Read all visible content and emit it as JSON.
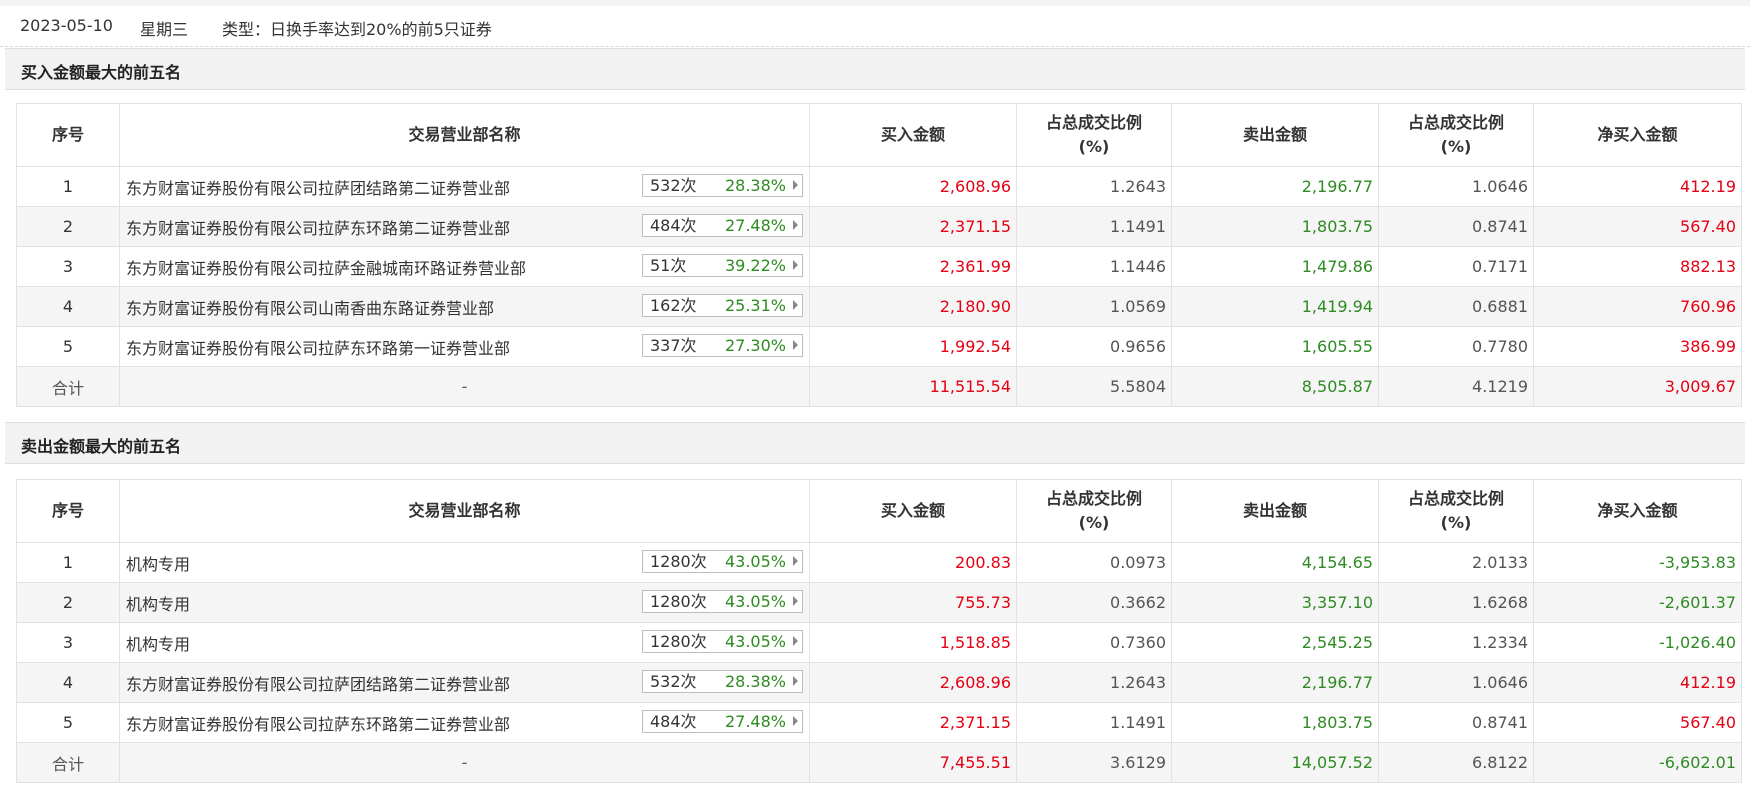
{
  "header": {
    "date": "2023-05-10",
    "weekday": "星期三",
    "type_text": "类型：日换手率达到20%的前5只证券"
  },
  "columns": {
    "idx": "序号",
    "name": "交易营业部名称",
    "buy": "买入金额",
    "buy_ratio_1": "占总成交比例",
    "buy_ratio_2": "(%)",
    "sell": "卖出金额",
    "sell_ratio_1": "占总成交比例",
    "sell_ratio_2": "(%)",
    "net": "净买入金额"
  },
  "colors": {
    "red": "#e60012",
    "green": "#2e8b22"
  },
  "buy_top5": {
    "title": "买入金额最大的前五名",
    "rows": [
      {
        "idx": "1",
        "name": "东方财富证券股份有限公司拉萨团结路第二证券营业部",
        "count": "532次",
        "rate": "28.38%",
        "buy": "2,608.96",
        "buy_ratio": "1.2643",
        "sell": "2,196.77",
        "sell_ratio": "1.0646",
        "net": "412.19",
        "net_sign": "pos"
      },
      {
        "idx": "2",
        "name": "东方财富证券股份有限公司拉萨东环路第二证券营业部",
        "count": "484次",
        "rate": "27.48%",
        "buy": "2,371.15",
        "buy_ratio": "1.1491",
        "sell": "1,803.75",
        "sell_ratio": "0.8741",
        "net": "567.40",
        "net_sign": "pos"
      },
      {
        "idx": "3",
        "name": "东方财富证券股份有限公司拉萨金融城南环路证券营业部",
        "count": "51次",
        "rate": "39.22%",
        "buy": "2,361.99",
        "buy_ratio": "1.1446",
        "sell": "1,479.86",
        "sell_ratio": "0.7171",
        "net": "882.13",
        "net_sign": "pos"
      },
      {
        "idx": "4",
        "name": "东方财富证券股份有限公司山南香曲东路证券营业部",
        "count": "162次",
        "rate": "25.31%",
        "buy": "2,180.90",
        "buy_ratio": "1.0569",
        "sell": "1,419.94",
        "sell_ratio": "0.6881",
        "net": "760.96",
        "net_sign": "pos"
      },
      {
        "idx": "5",
        "name": "东方财富证券股份有限公司拉萨东环路第一证券营业部",
        "count": "337次",
        "rate": "27.30%",
        "buy": "1,992.54",
        "buy_ratio": "0.9656",
        "sell": "1,605.55",
        "sell_ratio": "0.7780",
        "net": "386.99",
        "net_sign": "pos"
      }
    ],
    "total": {
      "label": "合计",
      "name": "-",
      "buy": "11,515.54",
      "buy_ratio": "5.5804",
      "sell": "8,505.87",
      "sell_ratio": "4.1219",
      "net": "3,009.67"
    }
  },
  "sell_top5": {
    "title": "卖出金额最大的前五名",
    "rows": [
      {
        "idx": "1",
        "name": "机构专用",
        "count": "1280次",
        "rate": "43.05%",
        "buy": "200.83",
        "buy_ratio": "0.0973",
        "sell": "4,154.65",
        "sell_ratio": "2.0133",
        "net": "-3,953.83",
        "net_sign": "neg"
      },
      {
        "idx": "2",
        "name": "机构专用",
        "count": "1280次",
        "rate": "43.05%",
        "buy": "755.73",
        "buy_ratio": "0.3662",
        "sell": "3,357.10",
        "sell_ratio": "1.6268",
        "net": "-2,601.37",
        "net_sign": "neg"
      },
      {
        "idx": "3",
        "name": "机构专用",
        "count": "1280次",
        "rate": "43.05%",
        "buy": "1,518.85",
        "buy_ratio": "0.7360",
        "sell": "2,545.25",
        "sell_ratio": "1.2334",
        "net": "-1,026.40",
        "net_sign": "neg"
      },
      {
        "idx": "4",
        "name": "东方财富证券股份有限公司拉萨团结路第二证券营业部",
        "count": "532次",
        "rate": "28.38%",
        "buy": "2,608.96",
        "buy_ratio": "1.2643",
        "sell": "2,196.77",
        "sell_ratio": "1.0646",
        "net": "412.19",
        "net_sign": "pos"
      },
      {
        "idx": "5",
        "name": "东方财富证券股份有限公司拉萨东环路第二证券营业部",
        "count": "484次",
        "rate": "27.48%",
        "buy": "2,371.15",
        "buy_ratio": "1.1491",
        "sell": "1,803.75",
        "sell_ratio": "0.8741",
        "net": "567.40",
        "net_sign": "pos"
      }
    ],
    "total": {
      "label": "合计",
      "name": "-",
      "buy": "7,455.51",
      "buy_ratio": "3.6129",
      "sell": "14,057.52",
      "sell_ratio": "6.8122",
      "net": "-6,602.01",
      "net_sign": "neg"
    }
  }
}
